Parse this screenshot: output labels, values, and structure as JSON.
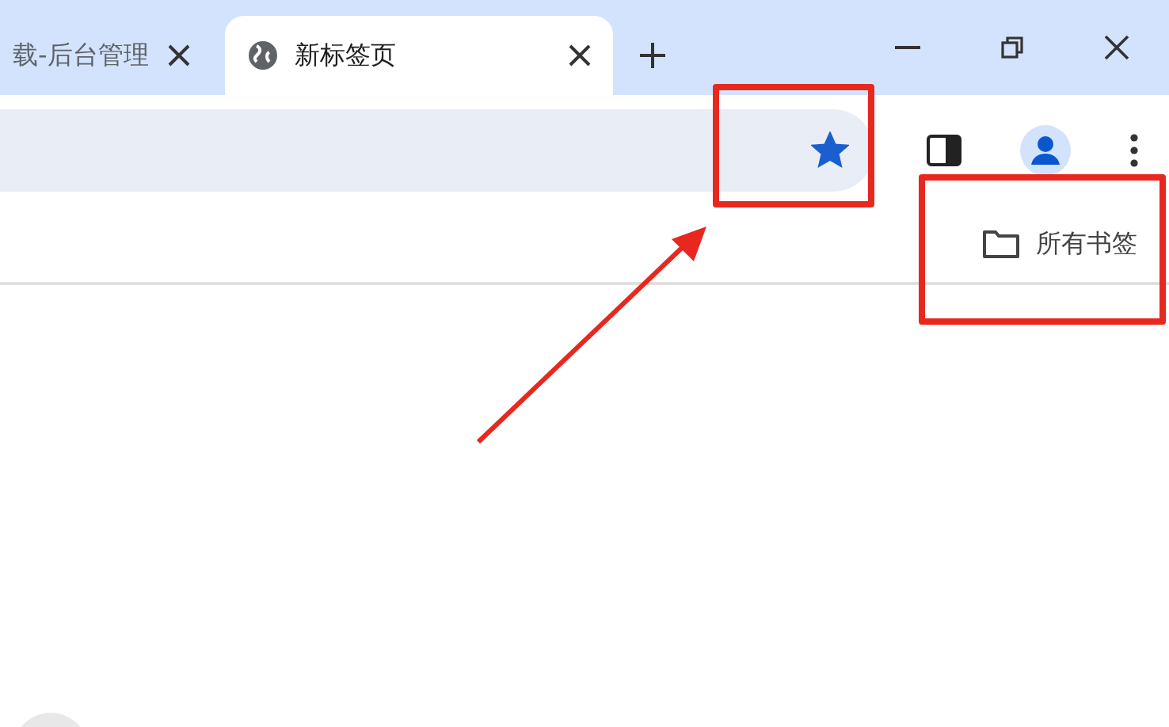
{
  "tabs": [
    {
      "label": "载-后台管理",
      "selected": false
    },
    {
      "label": "新标签页",
      "selected": true
    }
  ],
  "toolbar": {
    "bookmarked": true
  },
  "bookmarks_bar": {
    "items": [
      {
        "label": "所有书签"
      }
    ]
  },
  "annotations": [
    {
      "kind": "box"
    },
    {
      "kind": "box"
    },
    {
      "kind": "arrow"
    }
  ]
}
